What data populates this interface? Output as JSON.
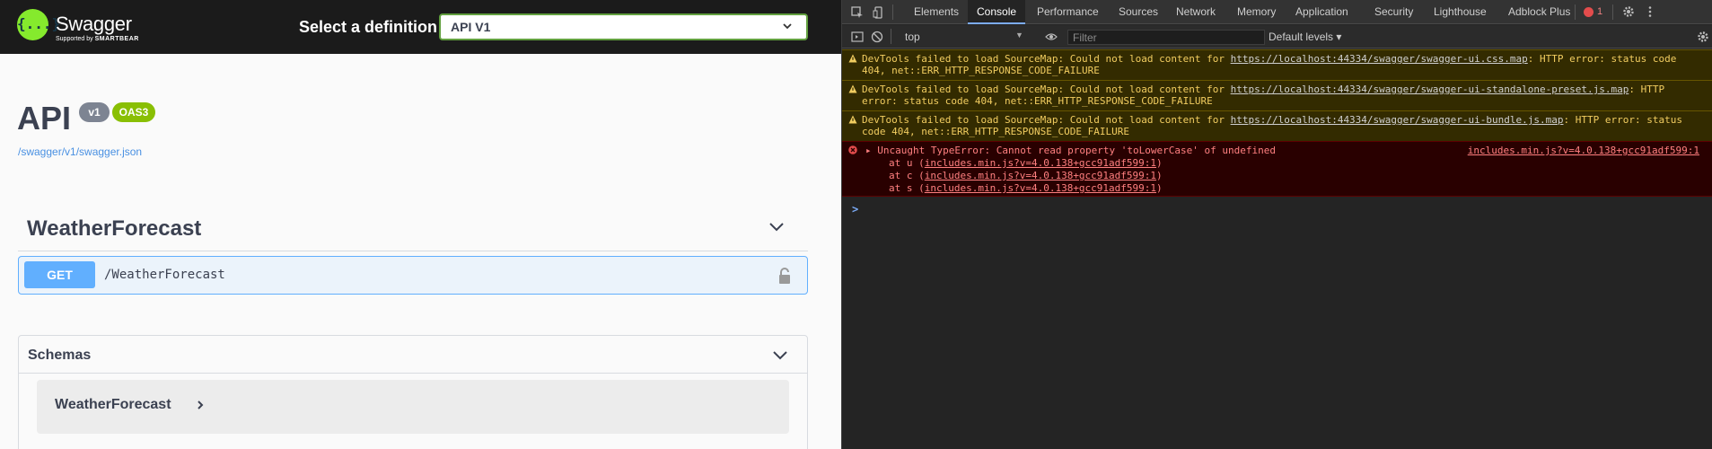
{
  "swagger": {
    "brand": {
      "logo_glyph": "{...}",
      "name": "Swagger",
      "tagline_prefix": "Supported by",
      "tagline_brand": "SMARTBEAR"
    },
    "definition": {
      "label": "Select a definition",
      "selected": "API V1"
    },
    "info": {
      "title": "API",
      "version_badge": "v1",
      "oas_badge": "OAS3",
      "spec_link": "/swagger/v1/swagger.json"
    },
    "tag": {
      "name": "WeatherForecast"
    },
    "operation": {
      "method": "GET",
      "path": "/WeatherForecast"
    },
    "schemas": {
      "title": "Schemas",
      "model": "WeatherForecast"
    },
    "colors": {
      "topbar": "#1b1b1b",
      "logo": "#85ea2d",
      "select_border": "#62a03f",
      "get_bg": "#ebf3fb",
      "get_method": "#61affe",
      "oas_badge": "#89bf04",
      "version_badge": "#7d8492"
    }
  },
  "devtools": {
    "tabs": [
      "Elements",
      "Console",
      "Performance",
      "Sources",
      "Network",
      "Memory",
      "Application",
      "Security",
      "Lighthouse",
      "Adblock Plus"
    ],
    "active_tab": "Console",
    "error_count": "1",
    "toolbar": {
      "context": "top",
      "filter_placeholder": "Filter",
      "levels": "Default levels"
    },
    "messages": [
      {
        "level": "warning",
        "text_before": "DevTools failed to load SourceMap: Could not load content for ",
        "url": "https://localhost:44334/swagger/swagger-ui.css.map",
        "text_after": ": HTTP error: status code 404, net::ERR_HTTP_RESPONSE_CODE_FAILURE"
      },
      {
        "level": "warning",
        "text_before": "DevTools failed to load SourceMap: Could not load content for ",
        "url": "https://localhost:44334/swagger/swagger-ui-standalone-preset.js.map",
        "text_after": ": HTTP error: status code 404, net::ERR_HTTP_RESPONSE_CODE_FAILURE"
      },
      {
        "level": "warning",
        "text_before": "DevTools failed to load SourceMap: Could not load content for ",
        "url": "https://localhost:44334/swagger/swagger-ui-bundle.js.map",
        "text_after": ": HTTP error: status code 404, net::ERR_HTTP_RESPONSE_CODE_FAILURE"
      }
    ],
    "error": {
      "text": "Uncaught TypeError: Cannot read property 'toLowerCase' of undefined",
      "source": "includes.min.js?v=4.0.138+gcc91adf599:1",
      "frames": [
        {
          "prefix": "at u (",
          "link": "includes.min.js?v=4.0.138+gcc91adf599:1",
          "suffix": ")"
        },
        {
          "prefix": "at c (",
          "link": "includes.min.js?v=4.0.138+gcc91adf599:1",
          "suffix": ")"
        },
        {
          "prefix": "at s (",
          "link": "includes.min.js?v=4.0.138+gcc91adf599:1",
          "suffix": ")"
        }
      ]
    },
    "prompt": ">"
  }
}
